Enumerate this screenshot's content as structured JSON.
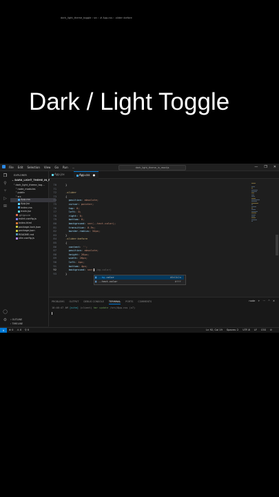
{
  "overlay_title": "Dark / Light Toggle",
  "titlebar": {
    "menu": [
      "File",
      "Edit",
      "Selection",
      "View",
      "Go",
      "Run",
      "..."
    ],
    "search_text": "dark_light_theme_in_reactjs",
    "controls": [
      "—",
      "❐",
      "✕"
    ]
  },
  "activity_icons": [
    "files-icon",
    "search-icon",
    "source-control-icon",
    "run-debug-icon",
    "extensions-icon"
  ],
  "explorer": {
    "header": "EXPLORER",
    "root": "DARK_LIGHT_THEME_IN_R...",
    "items": [
      {
        "label": "dark_light_theme_tog...",
        "indent": 1,
        "icon": "folder",
        "color": "#c5c5c5"
      },
      {
        "label": "node_modules",
        "indent": 2,
        "icon": "folder",
        "color": "#c5c5c5"
      },
      {
        "label": "public",
        "indent": 2,
        "icon": "folder",
        "color": "#c5c5c5"
      },
      {
        "label": "src",
        "indent": 2,
        "icon": "folder",
        "color": "#c5c5c5"
      },
      {
        "label": "App.css",
        "indent": 3,
        "icon": "css",
        "color": "#42a5f5",
        "selected": true
      },
      {
        "label": "App.jsx",
        "indent": 3,
        "icon": "react",
        "color": "#61dafb"
      },
      {
        "label": "index.css",
        "indent": 3,
        "icon": "css",
        "color": "#42a5f5"
      },
      {
        "label": "main.jsx",
        "indent": 3,
        "icon": "react",
        "color": "#61dafb"
      },
      {
        "label": ".gitignore",
        "indent": 2,
        "icon": "git",
        "color": "#e06c4c"
      },
      {
        "label": "eslint.config.js",
        "indent": 2,
        "icon": "eslint",
        "color": "#8080f2"
      },
      {
        "label": "index.html",
        "indent": 2,
        "icon": "html",
        "color": "#e37933"
      },
      {
        "label": "package-lock.json",
        "indent": 2,
        "icon": "json",
        "color": "#cbcb41"
      },
      {
        "label": "package.json",
        "indent": 2,
        "icon": "json",
        "color": "#cbcb41"
      },
      {
        "label": "README.md",
        "indent": 2,
        "icon": "md",
        "color": "#519aba"
      },
      {
        "label": "vite.config.js",
        "indent": 2,
        "icon": "vite",
        "color": "#b388ff"
      }
    ],
    "outline": "OUTLINE",
    "timeline": "TIMELINE"
  },
  "tabs": [
    {
      "label": "App.jsx",
      "active": false
    },
    {
      "label": "App.css",
      "active": true
    }
  ],
  "breadcrumb": "dark_light_theme_toggle  ›  src  ›  # App.css  ›  .slider::before",
  "code_lines": [
    {
      "ln": "70",
      "text": "}"
    },
    {
      "ln": "71",
      "text": ""
    },
    {
      "ln": "72",
      "text": ".slider"
    },
    {
      "ln": "73",
      "text": "{"
    },
    {
      "ln": "74",
      "text": "  position: absolute;"
    },
    {
      "ln": "75",
      "text": "  cursor: pointer;"
    },
    {
      "ln": "76",
      "text": "  top: 0;"
    },
    {
      "ln": "77",
      "text": "  left: 0;"
    },
    {
      "ln": "78",
      "text": "  right: 0;"
    },
    {
      "ln": "79",
      "text": "  bottom: 0;"
    },
    {
      "ln": "80",
      "text": "  background: var(--text-color);"
    },
    {
      "ln": "81",
      "text": "  transition: 0.5s;"
    },
    {
      "ln": "82",
      "text": "  border-radius: 34px;"
    },
    {
      "ln": "83",
      "text": "}"
    },
    {
      "ln": "84",
      "text": ".slider:before"
    },
    {
      "ln": "85",
      "text": "{"
    },
    {
      "ln": "86",
      "text": "  content: '';"
    },
    {
      "ln": "87",
      "text": "  position: absolute;"
    },
    {
      "ln": "88",
      "text": "  height: 26px;"
    },
    {
      "ln": "89",
      "text": "  width: 26px;"
    },
    {
      "ln": "90",
      "text": "  left: 4px;"
    },
    {
      "ln": "91",
      "text": "  bottom: 4px;"
    },
    {
      "ln": "92",
      "text": "  background: var("
    },
    {
      "ln": "93",
      "text": "}"
    }
  ],
  "ghost_text": "--bg-color",
  "suggestions": [
    {
      "name_hl": "--bg",
      "name_rest": "-color",
      "detail": "#0d1b2a",
      "active": true
    },
    {
      "name_hl": "",
      "name_rest": "--text-color",
      "detail": "#fff",
      "active": false
    }
  ],
  "panel": {
    "tabs": [
      "PROBLEMS",
      "OUTPUT",
      "DEBUG CONSOLE",
      "TERMINAL",
      "PORTS",
      "COMMENTS"
    ],
    "active_tab": "TERMINAL",
    "controls": [
      "node",
      "+",
      "⋯",
      "^",
      "✕"
    ],
    "terminal": {
      "time": "10:46:47 AM",
      "vite": "[vite]",
      "client": "(client)",
      "hmr": "hmr update",
      "path": "/src/App.css (x7)"
    }
  },
  "statusbar": {
    "remote": "⨯",
    "left": [
      "⊗ 0",
      "⚠ 0",
      "⚲ 0"
    ],
    "right": [
      "Ln 92, Col 19",
      "Spaces: 2",
      "UTF-8",
      "LF",
      "CSS",
      "⊘"
    ]
  }
}
